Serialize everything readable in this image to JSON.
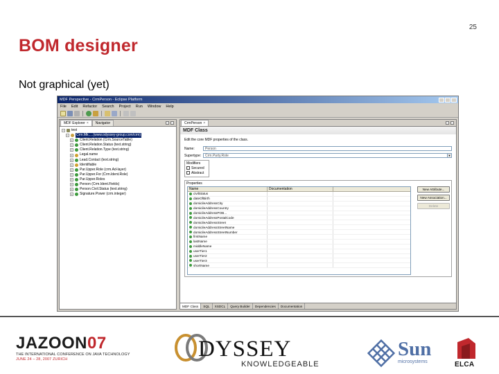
{
  "slide": {
    "number": "25",
    "title": "BOM designer",
    "subtitle": "Not graphical (yet)"
  },
  "eclipse": {
    "window_title": "MDF Perspective - CrmPerson - Eclipse Platform",
    "menu": [
      "File",
      "Edit",
      "Refactor",
      "Search",
      "Project",
      "Run",
      "Window",
      "Help"
    ],
    "left_tabs": [
      {
        "label": "MDF Explorer",
        "active": true
      },
      {
        "label": "Navigator",
        "active": false
      }
    ],
    "tree": {
      "root": "test",
      "selected": "Crm.Mk.....(www.odyssey-group.com/crm)",
      "items": [
        "Client.Relation (Crm.SourceTable)",
        "Client.Relation.Status (text.string)",
        "Client.Relation.Type (text.string)",
        "Legal.name",
        "Lead.Contact (text.string)",
        "Identifiable",
        "Par.Upper.Role (crm.Ad-layer)",
        "Par.Upper.For (Crm.Ident.Role)",
        "Par.Upper.Roles",
        "Person (Crm.Ident.Fields)",
        "Person.Civil.Status (text.string)",
        "Signature.Power (crm.integer)"
      ]
    },
    "editor_tab": "CrmPerson",
    "editor": {
      "header": "MDF Class",
      "description": "Edit the core MDF properties of the class.",
      "name_label": "Name:",
      "name_value": "Person",
      "supertype_label": "Supertype:",
      "supertype_value": "Crm.Party.Role",
      "modifiers_label": "Modifiers",
      "modifiers": [
        "Secured",
        "Abstract"
      ],
      "properties_label": "Properties",
      "columns": [
        "Name",
        "Documentation"
      ],
      "rows": [
        "civilStatus",
        "dateOfBirth",
        "domicileAddressCity",
        "domicileAddressCountry",
        "domicileAddressPOB...",
        "domicileAddressPostalCode",
        "domicileAddressStreet",
        "domicileAddressStreetName",
        "domicileAddressStreetNumber",
        "firstName",
        "lastName",
        "middleName",
        "userTier1",
        "userTier2",
        "userTier3",
        "shortName"
      ],
      "buttons": [
        "New Attribute...",
        "New Association...",
        "Delete"
      ],
      "bottom_tabs": [
        "MDF Class",
        "SQL",
        "XSDCL",
        "Query Builder",
        "Dependencies",
        "Documentation"
      ]
    }
  },
  "footer": {
    "jazoon_a": "JAZOON",
    "jazoon_b": "07",
    "jazoon_line1": "THE INTERNATIONAL CONFERENCE ON JAVA TECHNOLOGY",
    "jazoon_line2": "JUNE 24 – 28, 2007 ZURICH",
    "odyssey_word": "DYSSEY",
    "odyssey_tag": "KNOWLEDGEABLE",
    "sun_word": "Sun",
    "sun_sub": "microsystems",
    "elca_word": "ELCA"
  },
  "colors": {
    "title_red": "#c0282d",
    "sun_blue": "#4f6fa5"
  }
}
